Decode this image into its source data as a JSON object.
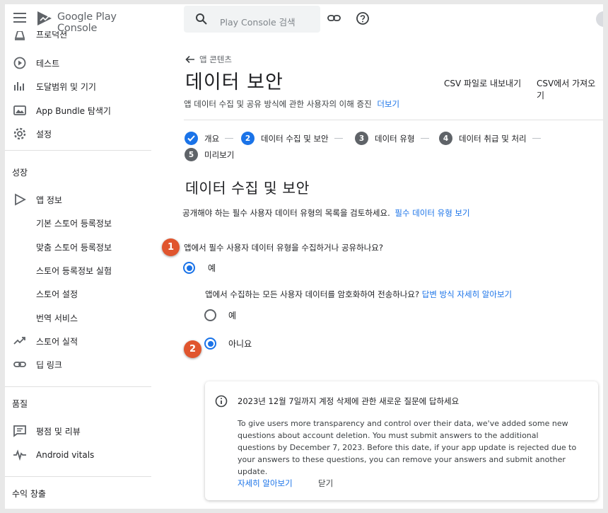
{
  "brand": {
    "name": "Google Play Console"
  },
  "sidebar": {
    "items_top": [
      {
        "label": "프로덕션",
        "icon": "production-icon"
      },
      {
        "label": "테스트",
        "icon": "testing-icon"
      },
      {
        "label": "도달범위 및 기기",
        "icon": "bar-chart-icon"
      },
      {
        "label": "App Bundle 탐색기",
        "icon": "bundle-icon"
      },
      {
        "label": "설정",
        "icon": "gear-icon"
      }
    ],
    "section_grow": "성장",
    "items_grow": [
      {
        "label": "앱 정보",
        "icon": "play-icon"
      },
      {
        "label": "기본 스토어 등록정보"
      },
      {
        "label": "맞춤 스토어 등록정보"
      },
      {
        "label": "스토어 등록정보 실험"
      },
      {
        "label": "스토어 설정"
      },
      {
        "label": "번역 서비스"
      },
      {
        "label": "스토어 실적",
        "icon": "trending-up-icon"
      },
      {
        "label": "딥 링크",
        "icon": "link-icon"
      }
    ],
    "section_quality": "품질",
    "items_quality": [
      {
        "label": "평점 및 리뷰",
        "icon": "review-icon"
      },
      {
        "label": "Android vitals",
        "icon": "vitals-icon"
      }
    ],
    "section_monetize": "수익 창출"
  },
  "search": {
    "placeholder": "Play Console 검색"
  },
  "header": {
    "back_label": "앱 콘텐츠",
    "title": "데이터 보안",
    "export_csv": "CSV 파일로 내보내기",
    "import_csv": "CSV에서 가져오기",
    "subtitle": "앱 데이터 수집 및 공유 방식에 관한 사용자의 이해 증진",
    "subtitle_link": "더보기"
  },
  "steps": [
    {
      "num": "",
      "label": "개요",
      "state": "done"
    },
    {
      "num": "2",
      "label": "데이터 수집 및 보안",
      "state": "active"
    },
    {
      "num": "3",
      "label": "데이터 유형",
      "state": "pending"
    },
    {
      "num": "4",
      "label": "데이터 취급 및 처리",
      "state": "pending"
    },
    {
      "num": "5",
      "label": "미리보기",
      "state": "pending"
    }
  ],
  "section": {
    "title": "데이터 수집 및 보안",
    "desc": "공개해야 하는 필수 사용자 데이터 유형의 목록을 검토하세요.",
    "desc_link": "필수 데이터 유형 보기"
  },
  "question1": {
    "text": "앱에서 필수 사용자 데이터 유형을 수집하거나 공유하나요?",
    "yes": "예",
    "selected": "yes"
  },
  "question2": {
    "text": "앱에서 수집하는 모든 사용자 데이터를 암호화하여 전송하나요?",
    "link": "답변 방식 자세히 알아보기",
    "yes": "예",
    "no": "아니요",
    "selected": "no"
  },
  "badges": {
    "b1": "1",
    "b2": "2"
  },
  "notice": {
    "title": "2023년 12월 7일까지 계정 삭제에 관한 새로운 질문에 답하세요",
    "body": "To give users more transparency and control over their data, we've added some new questions about account deletion. You must submit answers to the additional questions by December 7, 2023. Before this date, if your app update is rejected due to your answers to these questions, you can remove your answers and submit another update.",
    "learn_more": "자세히 알아보기",
    "close": "닫기"
  },
  "colors": {
    "accent": "#1a73e8",
    "badge": "#e0552e",
    "step_pending": "#5f6368"
  }
}
